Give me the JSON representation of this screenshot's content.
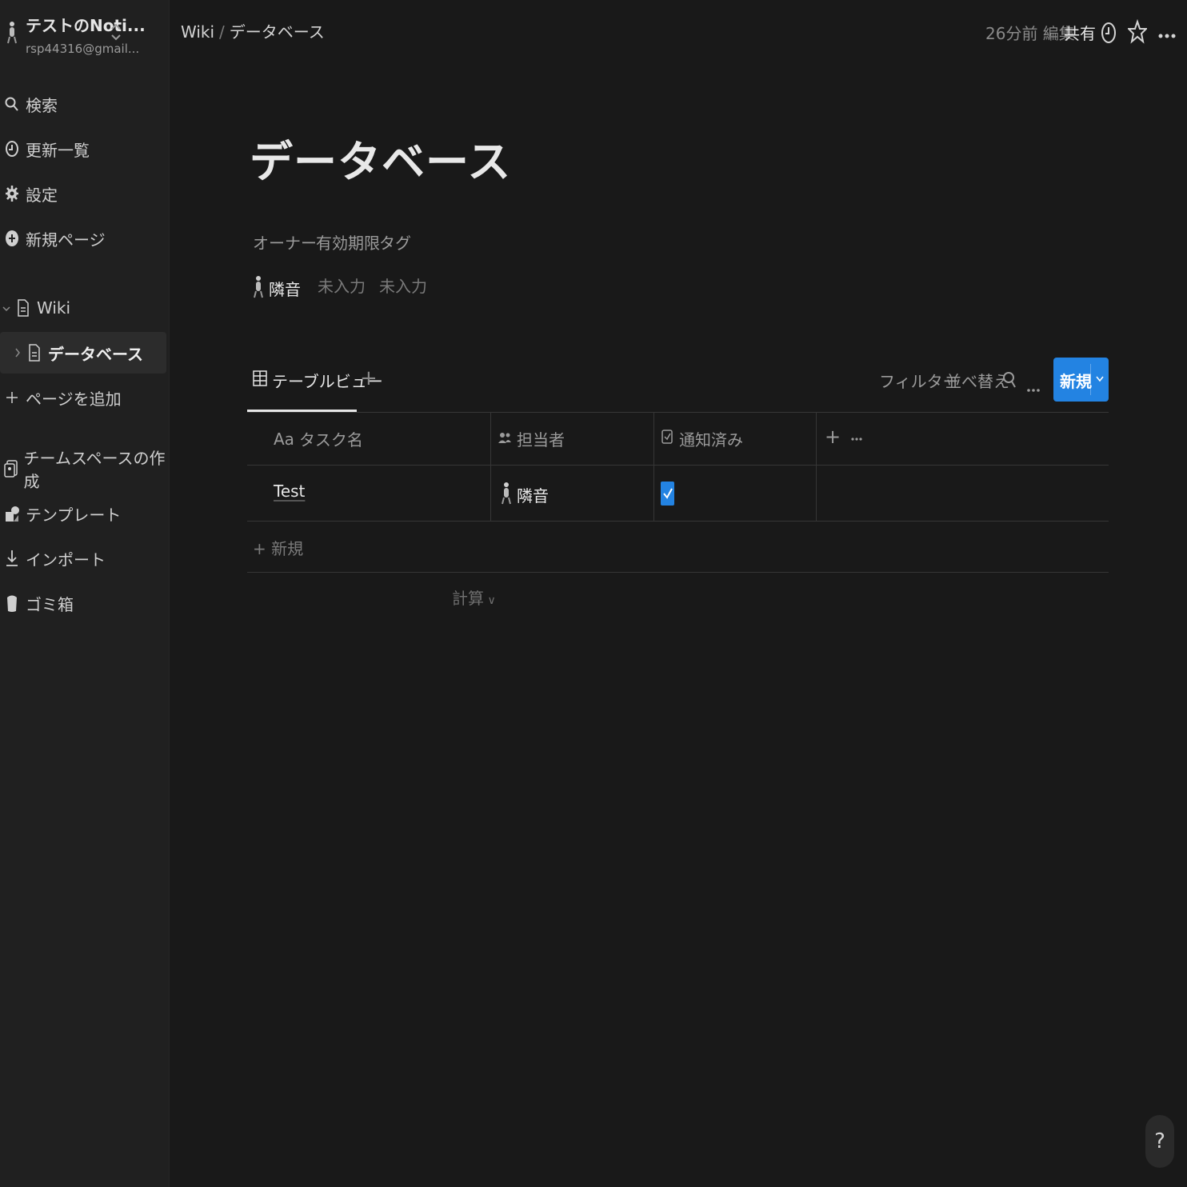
{
  "workspace": {
    "name": "テストのNoti...",
    "email": "rsp44316@gmail..."
  },
  "sidebar": {
    "top_items": [
      {
        "label": "検索",
        "icon": "search-icon"
      },
      {
        "label": "更新一覧",
        "icon": "clock-icon"
      },
      {
        "label": "設定",
        "icon": "gear-icon"
      },
      {
        "label": "新規ページ",
        "icon": "plus-circle-icon"
      }
    ],
    "pages": [
      {
        "label": "Wiki",
        "icon": "page-icon",
        "expanded": true
      },
      {
        "label": "データベース",
        "icon": "page-icon",
        "active": true
      }
    ],
    "add_page": "ページを追加",
    "bottom_items": [
      {
        "label": "チームスペースの作成",
        "icon": "teamspace-icon"
      },
      {
        "label": "テンプレート",
        "icon": "template-icon"
      },
      {
        "label": "インポート",
        "icon": "download-icon"
      },
      {
        "label": "ゴミ箱",
        "icon": "trash-icon"
      }
    ]
  },
  "topbar": {
    "breadcrumb": [
      "Wiki",
      "データベース"
    ],
    "edited": "26分前 編集",
    "share": "共有"
  },
  "page": {
    "title": "データベース",
    "properties": {
      "labels": [
        "オーナー",
        "有効期限",
        "タグ"
      ],
      "owner": "隣音",
      "due": "未入力",
      "tags": "未入力"
    }
  },
  "db": {
    "view_tab": "テーブルビュー",
    "filter": "フィルター",
    "sort": "並べ替え",
    "new_button": "新規",
    "columns": [
      {
        "label": "タスク名",
        "icon_text": "Aa"
      },
      {
        "label": "担当者",
        "icon": "people-icon"
      },
      {
        "label": "通知済み",
        "icon": "checkbox-icon"
      }
    ],
    "rows": [
      {
        "name": "Test",
        "assignee": "隣音",
        "notified": true
      }
    ],
    "new_row": "新規",
    "calc": "計算"
  },
  "help": "?",
  "colors": {
    "accent": "#2383e2",
    "background": "#191919",
    "sidebar": "#202020"
  }
}
